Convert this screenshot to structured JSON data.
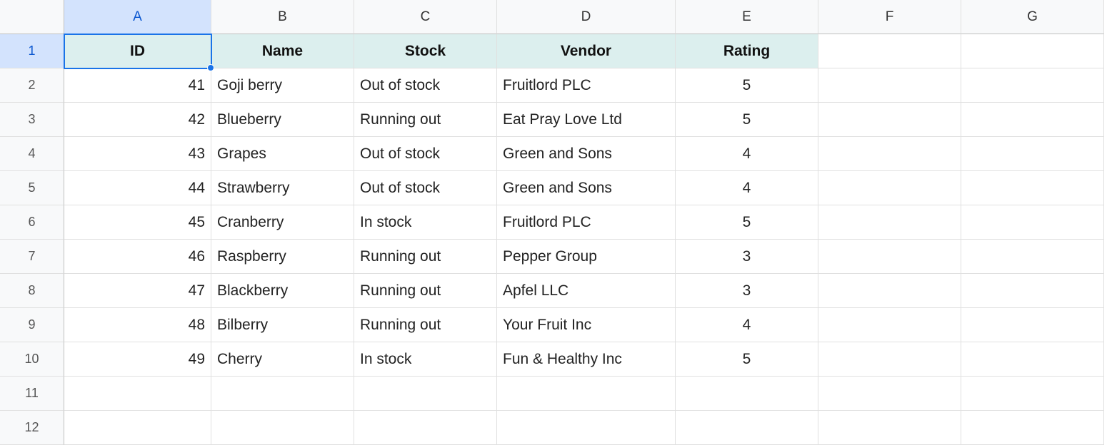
{
  "columns": [
    "A",
    "B",
    "C",
    "D",
    "E",
    "F",
    "G"
  ],
  "row_numbers": [
    1,
    2,
    3,
    4,
    5,
    6,
    7,
    8,
    9,
    10,
    11,
    12
  ],
  "headers": [
    "ID",
    "Name",
    "Stock",
    "Vendor",
    "Rating"
  ],
  "rows": [
    {
      "id": 41,
      "name": "Goji berry",
      "stock": "Out of stock",
      "vendor": "Fruitlord PLC",
      "rating": 5
    },
    {
      "id": 42,
      "name": "Blueberry",
      "stock": "Running out",
      "vendor": "Eat Pray Love Ltd",
      "rating": 5
    },
    {
      "id": 43,
      "name": "Grapes",
      "stock": "Out of stock",
      "vendor": "Green and Sons",
      "rating": 4
    },
    {
      "id": 44,
      "name": "Strawberry",
      "stock": "Out of stock",
      "vendor": "Green and Sons",
      "rating": 4
    },
    {
      "id": 45,
      "name": "Cranberry",
      "stock": "In stock",
      "vendor": "Fruitlord PLC",
      "rating": 5
    },
    {
      "id": 46,
      "name": "Raspberry",
      "stock": "Running out",
      "vendor": "Pepper Group",
      "rating": 3
    },
    {
      "id": 47,
      "name": "Blackberry",
      "stock": "Running out",
      "vendor": "Apfel LLC",
      "rating": 3
    },
    {
      "id": 48,
      "name": "Bilberry",
      "stock": "Running out",
      "vendor": "Your Fruit Inc",
      "rating": 4
    },
    {
      "id": 49,
      "name": "Cherry",
      "stock": "In stock",
      "vendor": "Fun & Healthy Inc",
      "rating": 5
    }
  ],
  "selected_cell": "A1",
  "header_bg": "#dcefee"
}
